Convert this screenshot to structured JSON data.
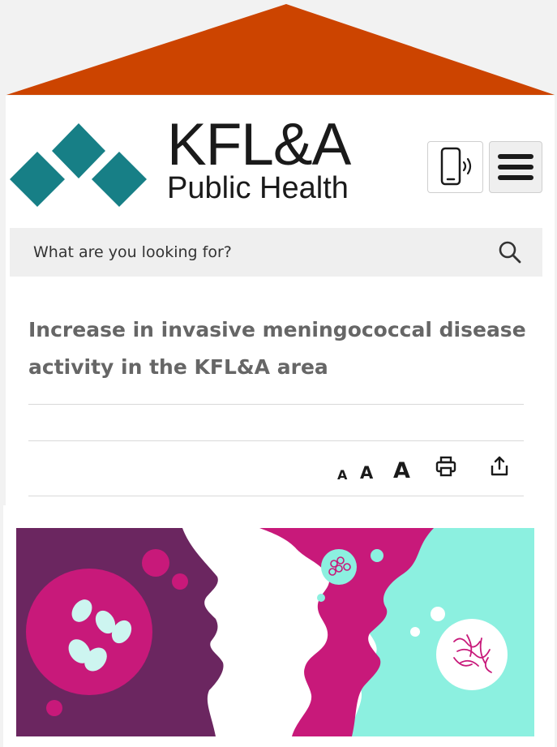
{
  "colors": {
    "roof": "#cc4400",
    "brand_teal": "#177f86",
    "hero_purple": "#6b2660",
    "hero_magenta": "#c8197a",
    "hero_mint": "#8cf0e0"
  },
  "header": {
    "logo_line1": "KFL&A",
    "logo_line2": "Public Health",
    "tts_icon": "mobile-speaker-icon",
    "menu_icon": "hamburger-menu-icon"
  },
  "search": {
    "placeholder": "What are you looking for?",
    "icon": "search-icon"
  },
  "article": {
    "title": "Increase in invasive meningococcal disease activity in the KFL&A area"
  },
  "tools": {
    "text_small": "A",
    "text_medium": "A",
    "text_large": "A",
    "print_icon": "printer-icon",
    "share_icon": "share-icon"
  },
  "hero": {
    "icon": "bacteria-illustration"
  }
}
